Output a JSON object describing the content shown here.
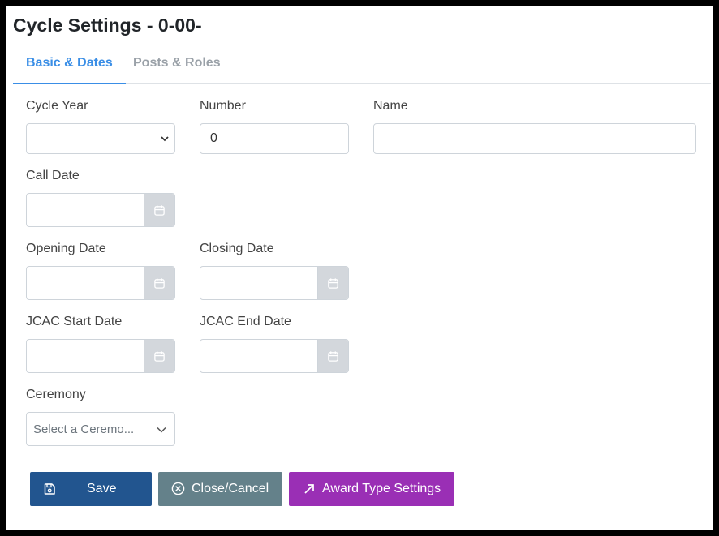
{
  "page": {
    "title": "Cycle Settings - 0-00-"
  },
  "tabs": [
    {
      "label": "Basic & Dates",
      "active": true
    },
    {
      "label": "Posts & Roles",
      "active": false
    }
  ],
  "form": {
    "cycle_year": {
      "label": "Cycle Year",
      "value": ""
    },
    "number": {
      "label": "Number",
      "value": "0"
    },
    "name": {
      "label": "Name",
      "value": ""
    },
    "call_date": {
      "label": "Call Date",
      "value": ""
    },
    "opening_date": {
      "label": "Opening Date",
      "value": ""
    },
    "closing_date": {
      "label": "Closing Date",
      "value": ""
    },
    "jcac_start_date": {
      "label": "JCAC Start Date",
      "value": ""
    },
    "jcac_end_date": {
      "label": "JCAC End Date",
      "value": ""
    },
    "ceremony": {
      "label": "Ceremony",
      "placeholder": "Select a Ceremo..."
    }
  },
  "buttons": {
    "save": "Save",
    "close": "Close/Cancel",
    "award": "Award Type Settings"
  },
  "icons": {
    "save": "floppy-disk-icon",
    "close": "circle-x-icon",
    "award": "arrow-up-right-icon",
    "calendar": "calendar-icon",
    "chevron": "chevron-down-icon"
  },
  "colors": {
    "accent": "#3a8ee6",
    "save_button": "#22558f",
    "close_button": "#64818a",
    "award_button": "#9a2fb5"
  }
}
